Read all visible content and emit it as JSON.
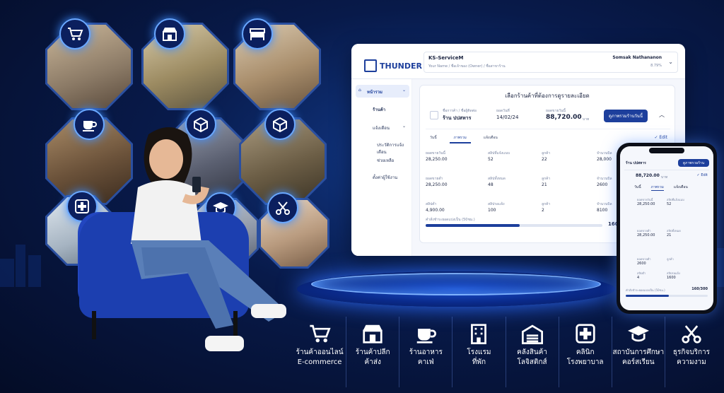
{
  "app": {
    "brand": "THUNDER",
    "service_name": "KS-ServiceM",
    "service_sub": "Your Name / ชื่อเจ้าของ (Owner) / ชื่อสาขาร้าน",
    "user_name": "Somsak Nathananon",
    "user_sub": "8.79%"
  },
  "sidebar": {
    "items": [
      {
        "label": "หน้ารวม"
      },
      {
        "label": "ร้านค้า"
      },
      {
        "label": "แจ้งเตือน"
      },
      {
        "label": "ประวัติการแจ้งเตือน"
      },
      {
        "label": "ช่วยเหลือ"
      },
      {
        "label": "ตั้งค่าผู้ใช้งาน"
      }
    ]
  },
  "panel": {
    "title": "เลือกร้านค้าที่ต้องการดูรายละเอียด",
    "store_label": "ชื่อการค้า / ชื่อผู้ติดต่อ",
    "store_name": "ร้าน ปปสหาร",
    "date_label": "ยอดวันที่",
    "date_value": "14/02/24",
    "amount_label": "ยอดขายวันนี้",
    "amount_value": "88,720.00",
    "amount_unit": "บาท",
    "summary_button": "ดูภาพรวมร้านวันนี้",
    "tabs": [
      "วันนี้",
      "ภาพรวม",
      "แจ้งเตือน"
    ],
    "edit_label": "Edit",
    "rows": [
      [
        {
          "label": "ยอดขายวันนี้",
          "value": "28,250.00"
        },
        {
          "label": "สลิปที่แจ้งแนบ",
          "value": "52"
        },
        {
          "label": "ลูกค้า",
          "value": "22"
        },
        {
          "label": "จำนวนบิล",
          "value": "28,000"
        }
      ],
      [
        {
          "label": "ยอดขายต่ำ",
          "value": "28,250.00"
        },
        {
          "label": "สลิปทั้งหมด",
          "value": "48"
        },
        {
          "label": "ลูกค้า",
          "value": "21"
        },
        {
          "label": "จำนวนบิล",
          "value": "2600"
        }
      ],
      [
        {
          "label": "สลิปต่ำ",
          "value": "4,900.00"
        },
        {
          "label": "สลิปรอแจ้ง",
          "value": "100"
        },
        {
          "label": "ลูกค้า",
          "value": "2"
        },
        {
          "label": "จำนวนบิล",
          "value": "8100"
        }
      ]
    ],
    "progress_label": "คำสั่งชำระยอดแบ่งเป็น (50ชม.)",
    "progress_text": "160/300",
    "progress_fraction": 0.53
  },
  "phone": {
    "store_name": "ร้าน ปปสหาร",
    "button": "ดูภาพรวมร้าน",
    "amount": "88,720.00",
    "amount_unit": "บาท",
    "edit": "Edit",
    "tabs": [
      "วันนี้",
      "ภาพรวม",
      "แจ้งเตือน"
    ],
    "cells": [
      {
        "label": "ยอดขายวันนี้",
        "value": "28,250.00"
      },
      {
        "label": "สลิปที่แจ้งแนบ",
        "value": "52"
      },
      {
        "label": "ยอดขายต่ำ",
        "value": "28,250.00"
      },
      {
        "label": "สลิปทั้งหมด",
        "value": "21"
      },
      {
        "label": "ยอดขายต่ำ",
        "value": "2600"
      },
      {
        "label": "ลูกค้า",
        "value": ""
      },
      {
        "label": "สลิปต่ำ",
        "value": "4"
      },
      {
        "label": "สลิปรอแจ้ง",
        "value": "1600"
      }
    ],
    "progress_label": "คำสั่งชำระยอดแบ่งเป็น (50ชม.)",
    "progress_text": "160/300",
    "progress_fraction": 0.53
  },
  "categories": [
    {
      "icon": "cart-icon",
      "l1": "ร้านค้าออนไลน์",
      "l2": "E-commerce"
    },
    {
      "icon": "store-icon",
      "l1": "ร้านค้าปลีก",
      "l2": "ค้าส่ง"
    },
    {
      "icon": "coffee-icon",
      "l1": "ร้านอาหาร",
      "l2": "คาเฟ่"
    },
    {
      "icon": "hotel-icon",
      "l1": "โรงแรม",
      "l2": "ที่พัก"
    },
    {
      "icon": "warehouse-icon",
      "l1": "คลังสินค้า",
      "l2": "โลจิสติกส์"
    },
    {
      "icon": "medical-cross-icon",
      "l1": "คลินิก",
      "l2": "โรงพยาบาล"
    },
    {
      "icon": "graduation-cap-icon",
      "l1": "สถาบันการศึกษา",
      "l2": "คอร์สเรียน"
    },
    {
      "icon": "scissors-icon",
      "l1": "ธุรกิจบริการ",
      "l2": "ความงาม"
    }
  ],
  "colors": {
    "accent": "#1d3f9c",
    "glow": "#3c8cff",
    "background": "#081a4a"
  }
}
